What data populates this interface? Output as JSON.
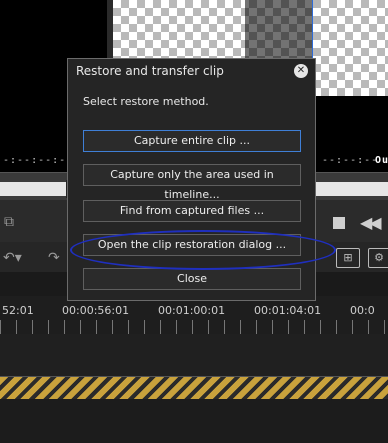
{
  "preview": {
    "timecode_left": "-:--:--:--",
    "timecode_right": "--:--:--",
    "out_label": "Ou"
  },
  "ruler": {
    "labels": [
      "52:01",
      "00:00:56:01",
      "00:01:00:01",
      "00:01:04:01",
      "00:0"
    ]
  },
  "dialog": {
    "title": "Restore and transfer clip",
    "close_glyph": "✕",
    "subtitle": "Select restore method.",
    "buttons": {
      "capture_entire": "Capture entire clip ...",
      "capture_area": "Capture only the area used in timeline...",
      "find_captured": "Find from captured files ...",
      "open_restoration": "Open the clip restoration dialog ...",
      "close": "Close"
    }
  },
  "colors": {
    "dialog_bg": "#252525",
    "focus_border": "#3f7fd6",
    "annotation": "#1f2fbf",
    "track_stripe": "#c9a23c"
  },
  "icons": {
    "toolbar_left": "clip-icon",
    "undo": "undo-icon",
    "redo": "redo-icon",
    "stop": "stop-icon",
    "rewind": "rewind-icon",
    "mixer": "mixer-icon",
    "settings": "settings-icon"
  }
}
